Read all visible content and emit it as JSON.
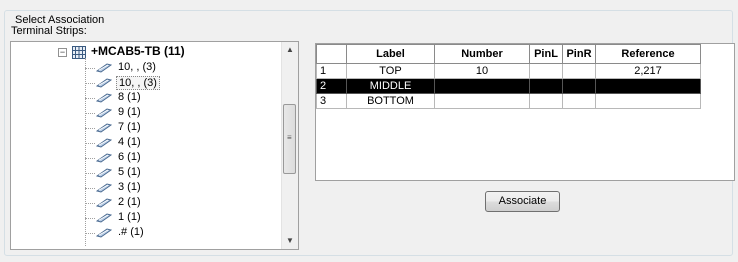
{
  "group": {
    "title": "Select Association"
  },
  "terminal_strips_label": "Terminal Strips:",
  "tree": {
    "root": {
      "label": "+MCAB5-TB (11)"
    },
    "items": [
      {
        "label": "10, , (3)"
      },
      {
        "label": "10, , (3)"
      },
      {
        "label": "8 (1)"
      },
      {
        "label": "9 (1)"
      },
      {
        "label": "7 (1)"
      },
      {
        "label": "4 (1)"
      },
      {
        "label": "6 (1)"
      },
      {
        "label": "5 (1)"
      },
      {
        "label": "3 (1)"
      },
      {
        "label": "2 (1)"
      },
      {
        "label": "1 (1)"
      },
      {
        "label": ".# (1)"
      }
    ]
  },
  "grid": {
    "columns": [
      "Label",
      "Number",
      "PinL",
      "PinR",
      "Reference"
    ],
    "rows": [
      {
        "num": "1",
        "label": "TOP",
        "number": "10",
        "pinl": "",
        "pinr": "",
        "reference": "2,217"
      },
      {
        "num": "2",
        "label": "MIDDLE",
        "number": "",
        "pinl": "",
        "pinr": "",
        "reference": ""
      },
      {
        "num": "3",
        "label": "BOTTOM",
        "number": "",
        "pinl": "",
        "pinr": "",
        "reference": ""
      }
    ]
  },
  "associate_button": "Associate",
  "icons": {
    "expander": "minus-box-icon",
    "root": "terminal-strip-icon",
    "item": "terminal-icon",
    "scroll_up": "up-arrow-icon",
    "scroll_down": "down-arrow-icon"
  },
  "colors": {
    "selected_row_bg": "#000000",
    "selected_row_text": "#ffffff"
  }
}
